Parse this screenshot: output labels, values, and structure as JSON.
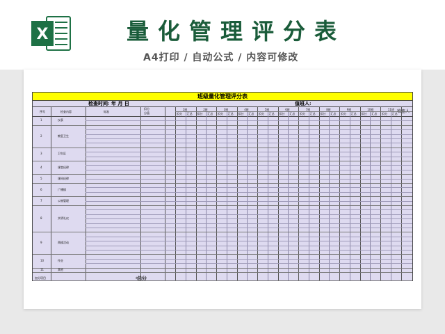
{
  "header": {
    "title": "量化管理评分表",
    "subtitle": "A4打印 / 自动公式 / 内容可修改",
    "logo_letter": "X"
  },
  "colors": {
    "brand": "#1a5c3a",
    "excel_green": "#1e7145",
    "title_bar": "#ffff00",
    "table_fill": "#dedaf0"
  },
  "sheet": {
    "title": "班级量化管理评分表",
    "check_time": "检查时间:   年   月   日",
    "duty": "值班人:",
    "col_no": "序号",
    "col_item": "检查内容",
    "col_std": "标准",
    "col_score": "分值",
    "col_project": "扣分",
    "checker": "检查人",
    "total": "总分",
    "days": [
      "1班",
      "2班",
      "3班",
      "4班",
      "5班",
      "6班",
      "7班",
      "8班",
      "9班",
      "10班",
      "11班"
    ],
    "sub_a": "扣分",
    "sub_b": "汇总",
    "groups": [
      {
        "no": "1",
        "name": "仪表"
      },
      {
        "no": "2",
        "name": "教室卫生"
      },
      {
        "no": "3",
        "name": "卫生区"
      },
      {
        "no": "4",
        "name": "课堂纪律"
      },
      {
        "no": "5",
        "name": "课间纪律"
      },
      {
        "no": "6",
        "name": "广播操"
      },
      {
        "no": "7",
        "name": "公物管理"
      },
      {
        "no": "8",
        "name": "文明礼仪"
      },
      {
        "no": "9",
        "name": "两操活动"
      },
      {
        "no": "10",
        "name": "作业"
      },
      {
        "no": "11",
        "name": "其他"
      }
    ],
    "std_note": "每项扣分",
    "extra_row": "加分项目"
  }
}
